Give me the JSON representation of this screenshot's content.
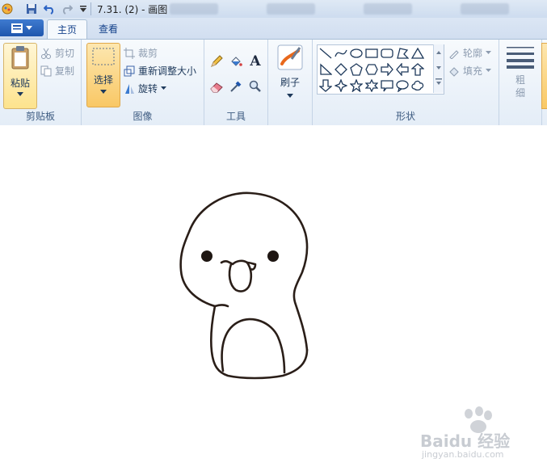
{
  "window": {
    "title": "7.31. (2) - 画图"
  },
  "tabs": [
    {
      "label": "主页",
      "active": true
    },
    {
      "label": "查看",
      "active": false
    }
  ],
  "clipboard": {
    "paste_label": "粘贴",
    "cut_label": "剪切",
    "copy_label": "复制",
    "group_label": "剪贴板"
  },
  "image": {
    "select_label": "选择",
    "crop_label": "裁剪",
    "resize_label": "重新调整大小",
    "rotate_label": "旋转",
    "group_label": "图像"
  },
  "tools": {
    "group_label": "工具",
    "text_glyph": "A"
  },
  "brushes": {
    "label": "刷子"
  },
  "shapes": {
    "group_label": "形状",
    "outline_label": "轮廓",
    "fill_label": "填充"
  },
  "size": {
    "label": "粗细"
  },
  "watermark": {
    "brand": "Baidu 经验",
    "url": "jingyan.baidu.com"
  },
  "colors": {
    "accent": "#1f56ad",
    "select_highlight": "#fbd48a",
    "ribbon_bg": "#e4edf7"
  }
}
